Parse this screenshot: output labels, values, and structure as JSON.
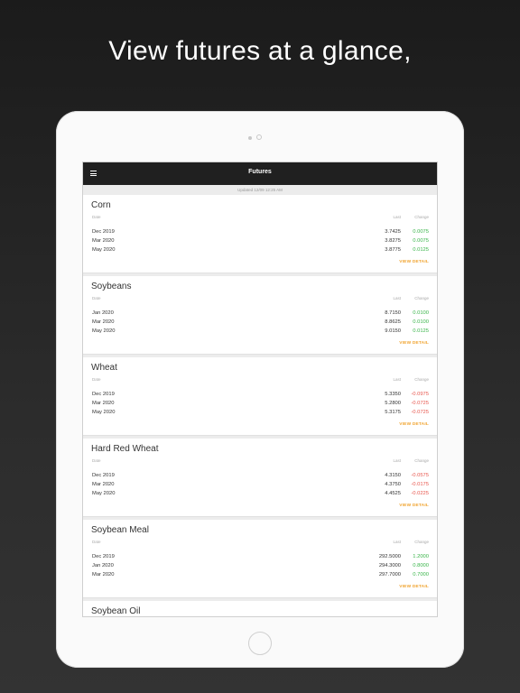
{
  "headline": "View futures at a glance,",
  "app": {
    "nav_title": "Futures",
    "updated": "Updated 12/09 12:25 AM"
  },
  "columns": {
    "date": "Date",
    "last": "Last",
    "change": "Change"
  },
  "view_detail": "VIEW DETAIL",
  "colors": {
    "positive": "#3ab54a",
    "negative": "#e8584f",
    "accent": "#f0a32e",
    "navbar": "#202020"
  },
  "cards": [
    {
      "title": "Corn",
      "rows": [
        {
          "date": "Dec 2019",
          "last": "3.7425",
          "change": "0.0075",
          "dir": "up"
        },
        {
          "date": "Mar 2020",
          "last": "3.8275",
          "change": "0.0075",
          "dir": "up"
        },
        {
          "date": "May 2020",
          "last": "3.8775",
          "change": "0.0125",
          "dir": "up"
        }
      ]
    },
    {
      "title": "Soybeans",
      "rows": [
        {
          "date": "Jan 2020",
          "last": "8.7150",
          "change": "0.0100",
          "dir": "up"
        },
        {
          "date": "Mar 2020",
          "last": "8.8625",
          "change": "0.0100",
          "dir": "up"
        },
        {
          "date": "May 2020",
          "last": "9.0150",
          "change": "0.0125",
          "dir": "up"
        }
      ]
    },
    {
      "title": "Wheat",
      "rows": [
        {
          "date": "Dec 2019",
          "last": "5.3350",
          "change": "-0.0975",
          "dir": "down"
        },
        {
          "date": "Mar 2020",
          "last": "5.2800",
          "change": "-0.0725",
          "dir": "down"
        },
        {
          "date": "May 2020",
          "last": "5.3175",
          "change": "-0.0725",
          "dir": "down"
        }
      ]
    },
    {
      "title": "Hard Red Wheat",
      "rows": [
        {
          "date": "Dec 2019",
          "last": "4.3150",
          "change": "-0.0575",
          "dir": "down"
        },
        {
          "date": "Mar 2020",
          "last": "4.3750",
          "change": "-0.0175",
          "dir": "down"
        },
        {
          "date": "May 2020",
          "last": "4.4525",
          "change": "-0.0225",
          "dir": "down"
        }
      ]
    },
    {
      "title": "Soybean Meal",
      "rows": [
        {
          "date": "Dec 2019",
          "last": "292.5000",
          "change": "1.2000",
          "dir": "up"
        },
        {
          "date": "Jan 2020",
          "last": "294.3000",
          "change": "0.8000",
          "dir": "up"
        },
        {
          "date": "Mar 2020",
          "last": "297.7000",
          "change": "0.7000",
          "dir": "up"
        }
      ]
    },
    {
      "title": "Soybean Oil",
      "rows": []
    }
  ]
}
